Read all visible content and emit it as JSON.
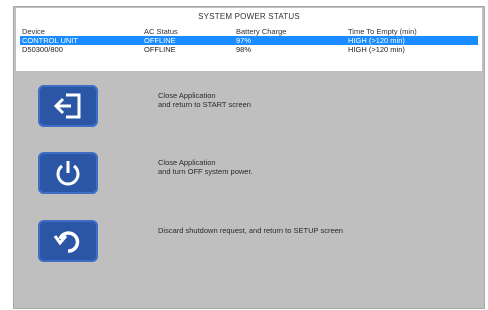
{
  "header": {
    "title": "SYSTEM POWER STATUS"
  },
  "table": {
    "columns": [
      "Device",
      "AC Status",
      "Battery Charge",
      "Time To Empty (min)"
    ],
    "rows": [
      [
        "CONTROL UNIT",
        "OFFLINE",
        "97%",
        "HIGH (>120 min)"
      ],
      [
        "D50300/800",
        "OFFLINE",
        "98%",
        "HIGH (>120 min)"
      ]
    ]
  },
  "actions": [
    {
      "icon": "exit-arrow-icon",
      "line1": "Close Application",
      "line2": "and return to START screen"
    },
    {
      "icon": "power-icon",
      "line1": "Close Application",
      "line2": "and turn OFF system power."
    },
    {
      "icon": "return-arrow-icon",
      "line1": "Discard shutdown request, and return to SETUP screen",
      "line2": ""
    }
  ],
  "colors": {
    "button": "#2b56a6",
    "selected_row": "#1a8cff",
    "background": "#bfbfbf"
  }
}
